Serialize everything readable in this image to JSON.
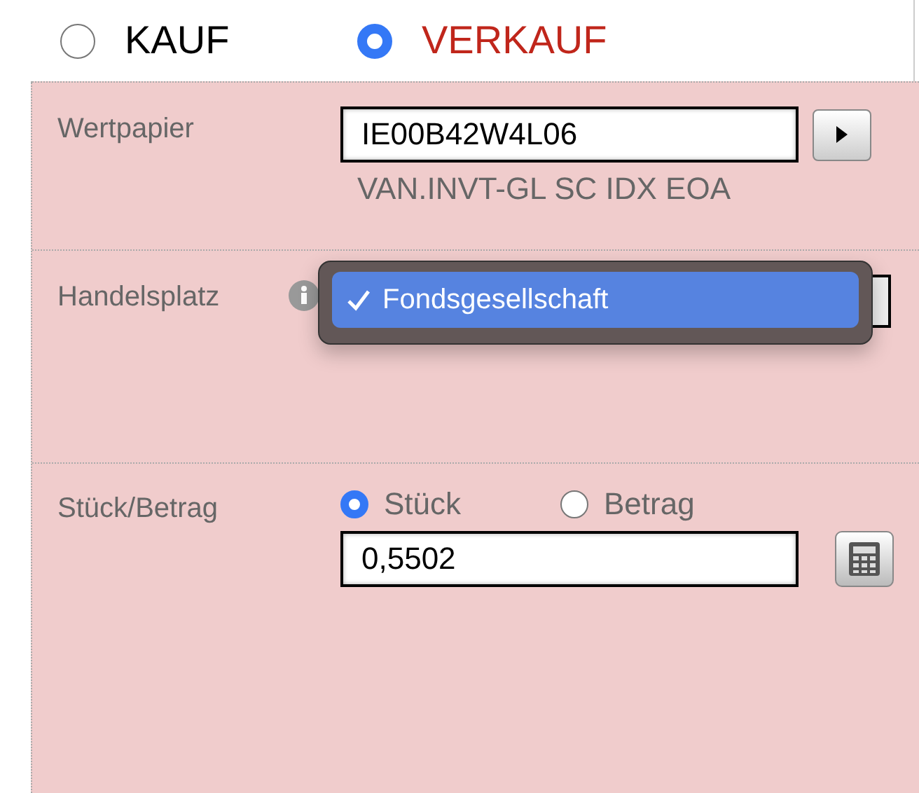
{
  "order_type": [
    {
      "label": "KAUF",
      "selected": false
    },
    {
      "label": "VERKAUF",
      "selected": true
    }
  ],
  "security": {
    "label": "Wertpapier",
    "value": "IE00B42W4L06",
    "name": "VAN.INVT-GL SC IDX EOA"
  },
  "venue": {
    "label": "Handelsplatz",
    "options": [
      {
        "label": "Fondsgesellschaft",
        "selected": true
      }
    ]
  },
  "quantity": {
    "label": "Stück/Betrag",
    "modes": [
      {
        "label": "Stück",
        "selected": true
      },
      {
        "label": "Betrag",
        "selected": false
      }
    ],
    "value": "0,5502"
  }
}
